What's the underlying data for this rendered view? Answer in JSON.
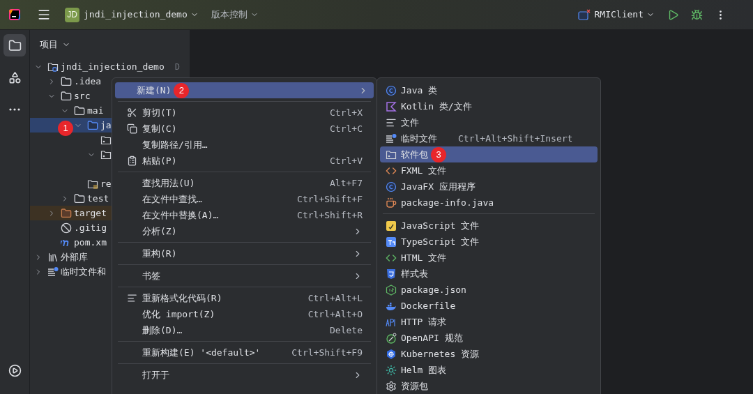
{
  "toolbar": {
    "project_badge": "JD",
    "project_name": "jndi_injection_demo",
    "vcs_menu": "版本控制",
    "run_config": "RMIClient"
  },
  "sidebar": {
    "items": [
      {
        "selected": true
      },
      {
        "selected": false
      },
      {
        "selected": false
      }
    ]
  },
  "project_panel": {
    "title": "项目",
    "tree": [
      {
        "label": "jndi_injection_demo",
        "hint": "D",
        "kind": "module",
        "expanded": true,
        "selected": false,
        "children": [
          {
            "label": ".idea",
            "kind": "folder",
            "expanded": false,
            "selected": false
          },
          {
            "label": "src",
            "kind": "folder",
            "expanded": true,
            "selected": false,
            "children": [
              {
                "label": "mai",
                "kind": "folder",
                "expanded": true,
                "selected": false,
                "children": [
                  {
                    "label": "ja",
                    "kind": "source",
                    "expanded": true,
                    "selected": true,
                    "badge": "1",
                    "children": [
                      {
                        "kind": "package",
                        "selected": false
                      },
                      {
                        "kind": "package",
                        "expanded": true,
                        "selected": false
                      }
                    ]
                  },
                  {
                    "label": "re",
                    "kind": "resources",
                    "selected": false
                  }
                ]
              },
              {
                "label": "test",
                "kind": "folder",
                "expanded": false,
                "selected": false
              }
            ]
          },
          {
            "label": "target",
            "kind": "excluded",
            "expanded": false,
            "selected": false
          },
          {
            "label": ".gitig",
            "kind": "ignore",
            "selected": false
          },
          {
            "label": "pom.xm",
            "kind": "maven",
            "selected": false
          }
        ]
      },
      {
        "label": "外部库",
        "kind": "library",
        "expanded": false,
        "selected": false
      },
      {
        "label": "临时文件和",
        "kind": "scratch",
        "expanded": false,
        "selected": false
      }
    ]
  },
  "context_menu": {
    "groups": [
      [
        {
          "label": "新建(N)",
          "submenu": true,
          "selected": true,
          "badge": "2"
        }
      ],
      [
        {
          "label": "剪切(T)",
          "shortcut": "Ctrl+X",
          "selected": false
        },
        {
          "label": "复制(C)",
          "shortcut": "Ctrl+C",
          "selected": false
        },
        {
          "label": "复制路径/引用…",
          "selected": false
        },
        {
          "label": "粘贴(P)",
          "shortcut": "Ctrl+V",
          "selected": false
        }
      ],
      [
        {
          "label": "查找用法(U)",
          "shortcut": "Alt+F7",
          "selected": false
        },
        {
          "label": "在文件中查找…",
          "shortcut": "Ctrl+Shift+F",
          "selected": false
        },
        {
          "label": "在文件中替换(A)…",
          "shortcut": "Ctrl+Shift+R",
          "selected": false
        },
        {
          "label": "分析(Z)",
          "submenu": true,
          "selected": false
        }
      ],
      [
        {
          "label": "重构(R)",
          "submenu": true,
          "selected": false
        }
      ],
      [
        {
          "label": "书签",
          "submenu": true,
          "selected": false
        }
      ],
      [
        {
          "label": "重新格式化代码(R)",
          "shortcut": "Ctrl+Alt+L",
          "selected": false
        },
        {
          "label": "优化 import(Z)",
          "shortcut": "Ctrl+Alt+O",
          "selected": false
        },
        {
          "label": "删除(D)…",
          "shortcut": "Delete",
          "selected": false
        }
      ],
      [
        {
          "label": "重新构建(E) '<default>'",
          "shortcut": "Ctrl+Shift+F9",
          "selected": false
        }
      ],
      [
        {
          "label": "打开于",
          "submenu": true,
          "selected": false
        }
      ]
    ]
  },
  "new_submenu": {
    "groups": [
      [
        {
          "label": "Java 类",
          "selected": false
        },
        {
          "label": "Kotlin 类/文件",
          "selected": false
        },
        {
          "label": "文件",
          "selected": false
        },
        {
          "label": "临时文件",
          "shortcut": "Ctrl+Alt+Shift+Insert",
          "selected": false
        },
        {
          "label": "软件包",
          "selected": true,
          "badge": "3"
        },
        {
          "label": "FXML 文件",
          "selected": false
        },
        {
          "label": "JavaFX 应用程序",
          "selected": false
        },
        {
          "label": "package-info.java",
          "selected": false
        }
      ],
      [
        {
          "label": "JavaScript 文件",
          "selected": false
        },
        {
          "label": "TypeScript 文件",
          "selected": false
        },
        {
          "label": "HTML 文件",
          "selected": false
        },
        {
          "label": "样式表",
          "selected": false
        },
        {
          "label": "package.json",
          "selected": false
        },
        {
          "label": "Dockerfile",
          "selected": false
        },
        {
          "label": "HTTP 请求",
          "selected": false
        },
        {
          "label": "OpenAPI 规范",
          "selected": false
        },
        {
          "label": "Kubernetes 资源",
          "selected": false
        },
        {
          "label": "Helm 图表",
          "selected": false
        },
        {
          "label": "资源包",
          "selected": false
        }
      ]
    ]
  }
}
